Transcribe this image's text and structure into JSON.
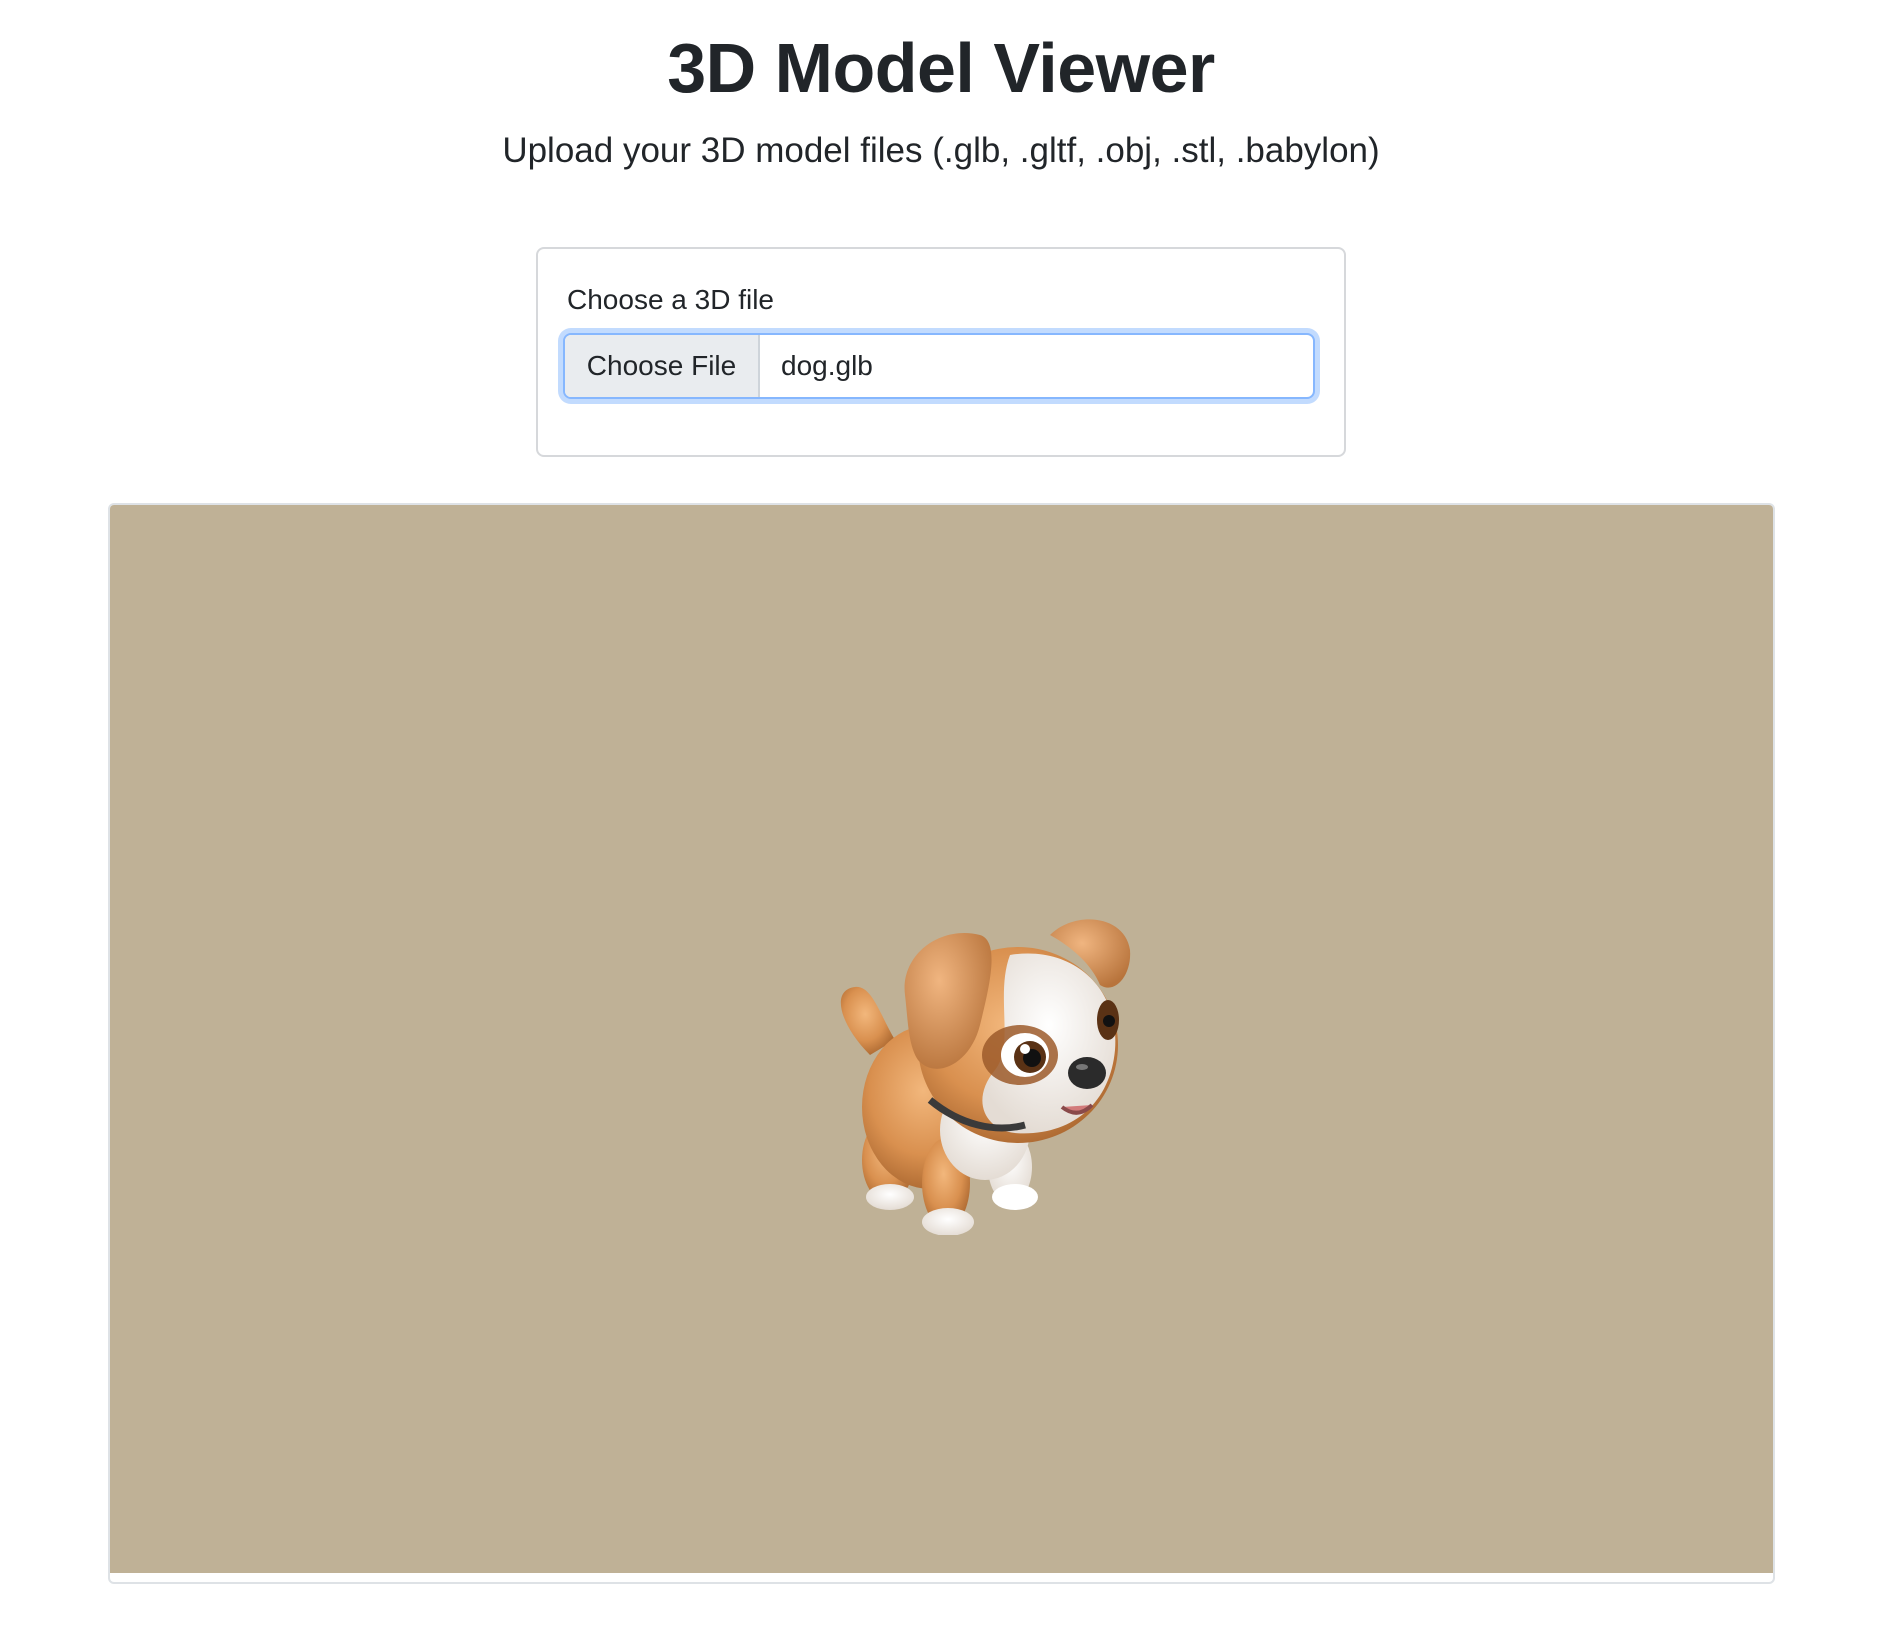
{
  "header": {
    "title": "3D Model Viewer",
    "subtitle": "Upload your 3D model files (.glb, .gltf, .obj, .stl, .babylon)"
  },
  "upload": {
    "label": "Choose a 3D file",
    "button_label": "Choose File",
    "file_name": "dog.glb"
  },
  "viewer": {
    "background_color": "#bfb196",
    "model_icon": "puppy-3d-model"
  },
  "colors": {
    "focus_ring": "#86b7fe",
    "text": "#212529"
  }
}
